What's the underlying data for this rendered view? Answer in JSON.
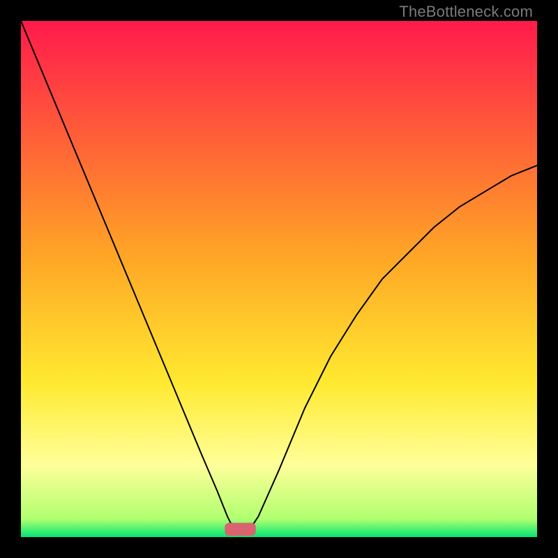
{
  "watermark": "TheBottleneck.com",
  "chart_data": {
    "type": "line",
    "title": "",
    "xlabel": "",
    "ylabel": "",
    "xlim": [
      0,
      100
    ],
    "ylim": [
      0,
      100
    ],
    "grid": false,
    "legend": false,
    "background_gradient": [
      {
        "pos": 0.0,
        "color": "#ff1a4b"
      },
      {
        "pos": 0.45,
        "color": "#ffa426"
      },
      {
        "pos": 0.7,
        "color": "#ffe92f"
      },
      {
        "pos": 0.86,
        "color": "#ffff9a"
      },
      {
        "pos": 0.965,
        "color": "#b0ff6f"
      },
      {
        "pos": 1.0,
        "color": "#00e676"
      }
    ],
    "marker": {
      "x": 42.5,
      "y": 1.5,
      "width": 6,
      "height": 2.5,
      "color": "#d9636e"
    },
    "series": [
      {
        "name": "left-curve",
        "color": "#000000",
        "stroke_width": 2,
        "x": [
          0,
          5,
          10,
          15,
          20,
          25,
          30,
          35,
          38,
          40,
          41,
          42
        ],
        "y": [
          100,
          88,
          76,
          64,
          52,
          40,
          28,
          16,
          9,
          4,
          2,
          1
        ]
      },
      {
        "name": "right-curve",
        "color": "#000000",
        "stroke_width": 2,
        "x": [
          44,
          46,
          50,
          55,
          60,
          65,
          70,
          75,
          80,
          85,
          90,
          95,
          100
        ],
        "y": [
          1,
          4,
          13,
          25,
          35,
          43,
          50,
          55,
          60,
          64,
          67,
          70,
          72
        ]
      }
    ]
  }
}
